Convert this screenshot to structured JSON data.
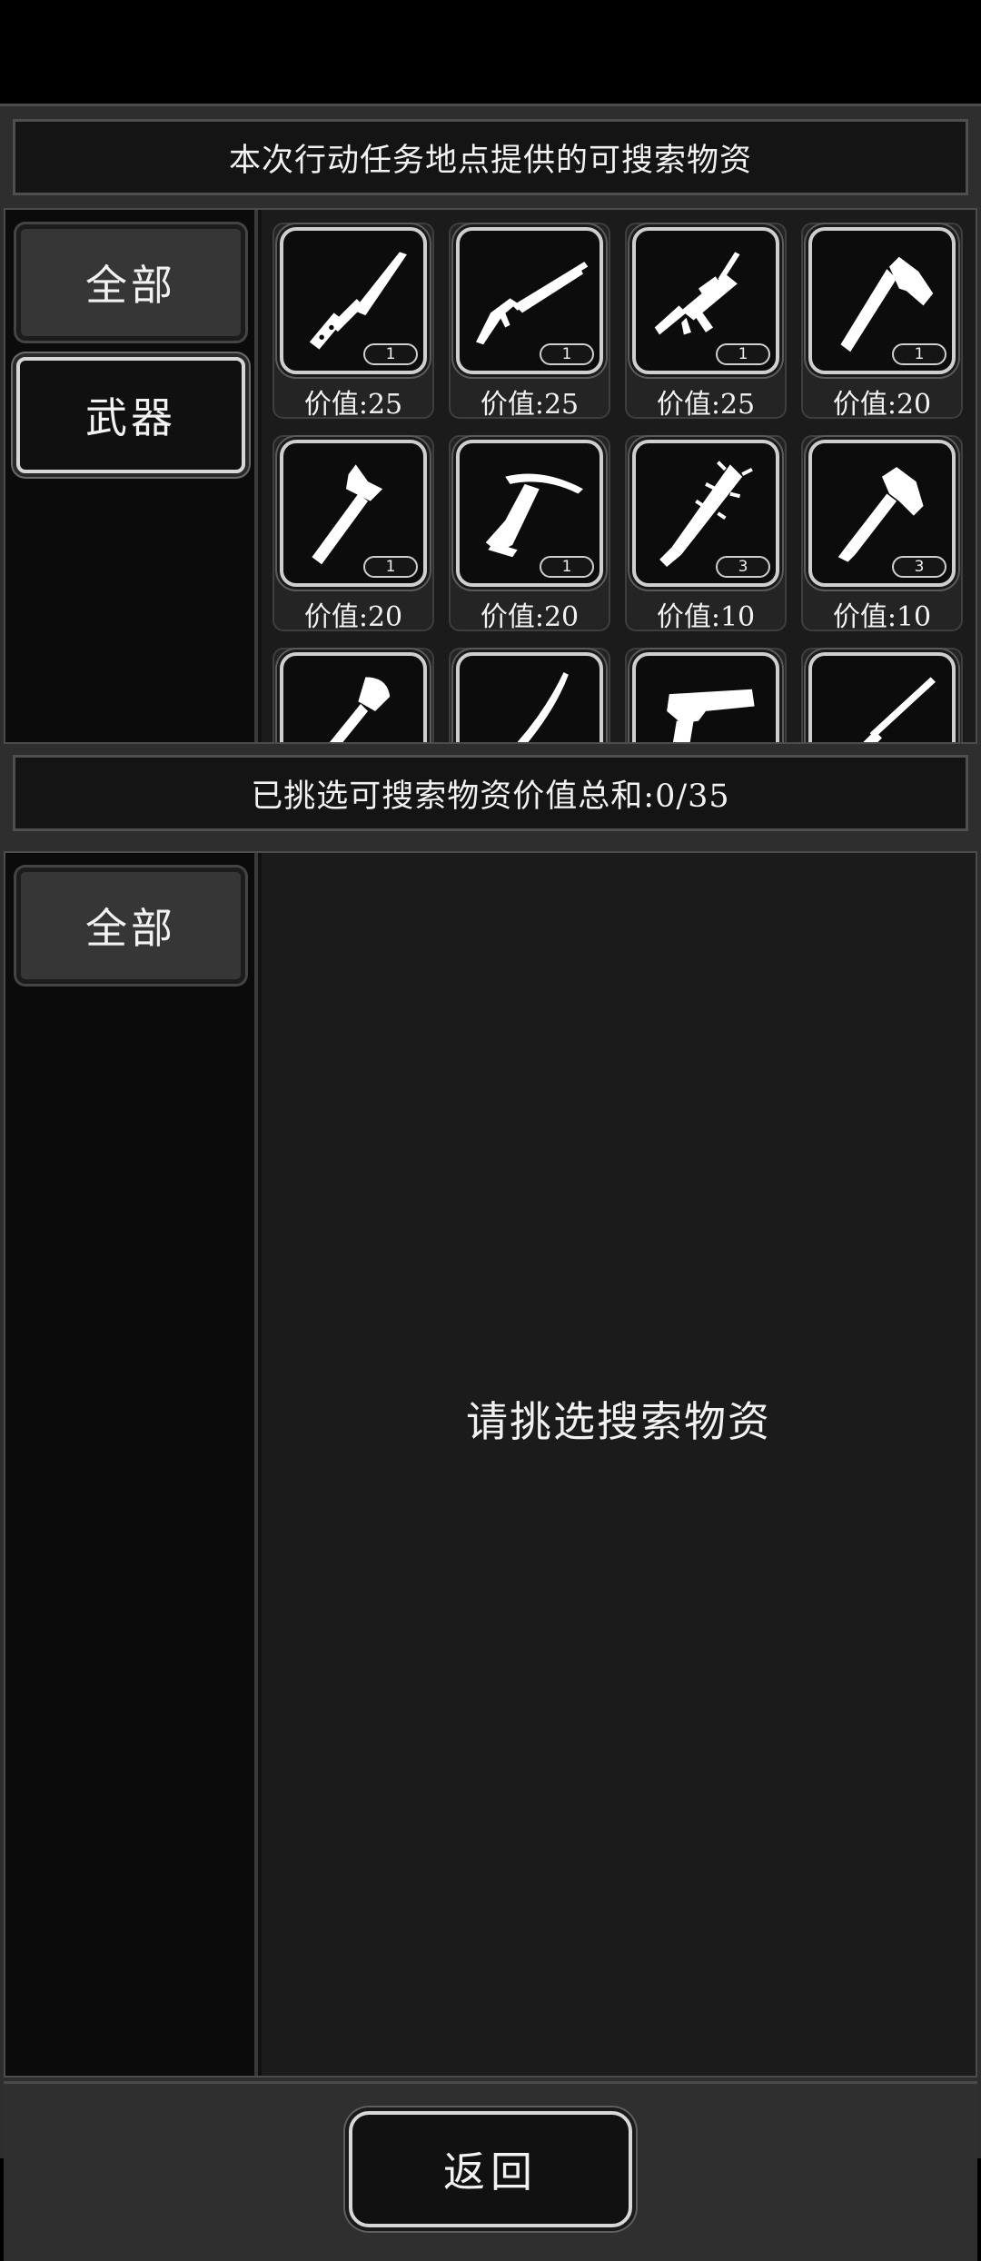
{
  "top_banner": {
    "title": "本次行动任务地点提供的可搜索物资"
  },
  "available": {
    "tabs": [
      {
        "label": "全部",
        "state": "active"
      },
      {
        "label": "武器",
        "state": "inactive"
      }
    ],
    "items": [
      {
        "icon": "knife-icon",
        "qty": "1",
        "price": "价值:25"
      },
      {
        "icon": "shotgun-icon",
        "qty": "1",
        "price": "价值:25"
      },
      {
        "icon": "assault-rifle-icon",
        "qty": "1",
        "price": "价值:25"
      },
      {
        "icon": "axe-icon",
        "qty": "1",
        "price": "价值:20"
      },
      {
        "icon": "hammer-axe-icon",
        "qty": "1",
        "price": "价值:20"
      },
      {
        "icon": "crossbow-icon",
        "qty": "1",
        "price": "价值:20"
      },
      {
        "icon": "spiked-bat-icon",
        "qty": "3",
        "price": "价值:10"
      },
      {
        "icon": "hatchet-icon",
        "qty": "3",
        "price": "价值:10"
      },
      {
        "icon": "shovel-icon",
        "qty": "",
        "price": ""
      },
      {
        "icon": "machete-icon",
        "qty": "",
        "price": ""
      },
      {
        "icon": "pistol-icon",
        "qty": "",
        "price": ""
      },
      {
        "icon": "rifle-icon",
        "qty": "",
        "price": ""
      }
    ]
  },
  "selected_banner": {
    "title": "已挑选可搜索物资价值总和:0/35"
  },
  "selected": {
    "tabs": [
      {
        "label": "全部",
        "state": "active"
      }
    ],
    "empty_message": "请挑选搜索物资"
  },
  "footer": {
    "back_label": "返回"
  },
  "colors": {
    "background": "#000000",
    "panel": "#2e2e2e",
    "tile": "#0c0c0c",
    "tile_border": "#cfcfcf",
    "text": "#f2f2f2"
  }
}
